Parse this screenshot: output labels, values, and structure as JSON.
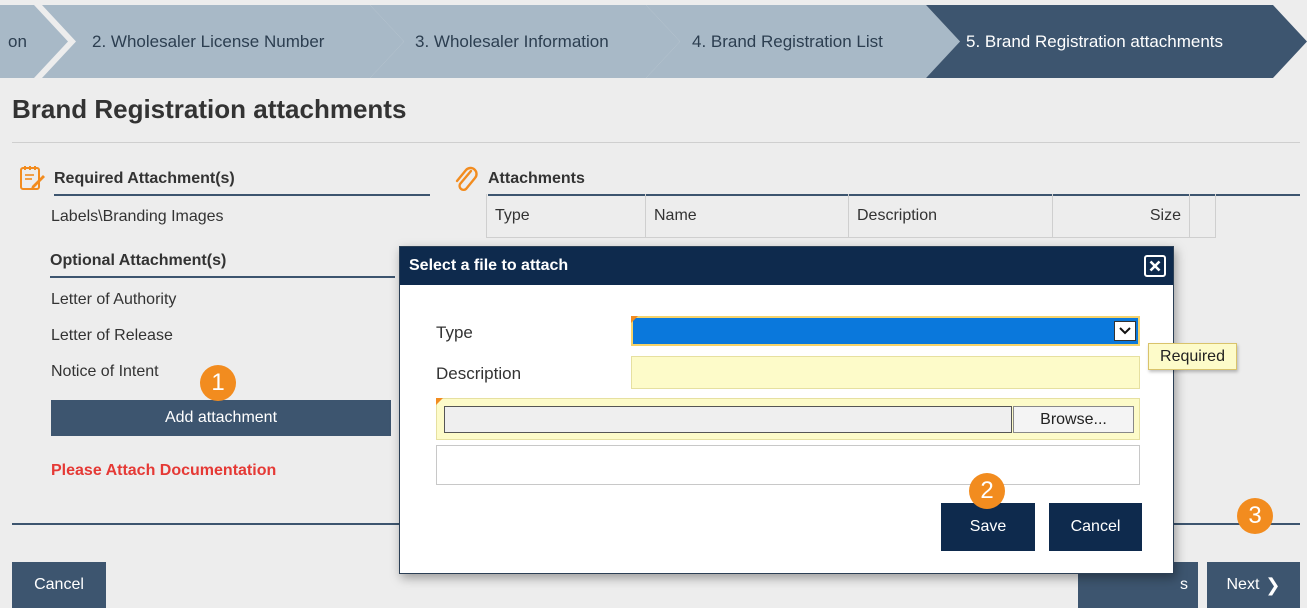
{
  "steps": [
    {
      "label": "on"
    },
    {
      "label": "2. Wholesaler License Number"
    },
    {
      "label": "3. Wholesaler Information"
    },
    {
      "label": "4. Brand Registration List"
    },
    {
      "label": "5. Brand Registration attachments"
    }
  ],
  "page": {
    "title": "Brand Registration attachments"
  },
  "required": {
    "heading": "Required Attachment(s)",
    "items": [
      "Labels\\Branding Images"
    ]
  },
  "optional": {
    "heading": "Optional Attachment(s)",
    "items": [
      "Letter of Authority",
      "Letter of Release",
      "Notice of Intent"
    ]
  },
  "add_attachment_label": "Add attachment",
  "warning": "Please Attach Documentation",
  "attachments": {
    "heading": "Attachments",
    "columns": [
      "Type",
      "Name",
      "Description",
      "Size"
    ]
  },
  "modal": {
    "title": "Select a file to attach",
    "type_label": "Type",
    "description_label": "Description",
    "browse_label": "Browse...",
    "save_label": "Save",
    "cancel_label": "Cancel"
  },
  "tooltip": "Required",
  "footer": {
    "cancel_label": "Cancel",
    "previous_partial": "s",
    "next_label": "Next"
  },
  "badges": [
    "1",
    "2",
    "3"
  ],
  "colors": {
    "step_inactive": "#a8b9c7",
    "step_active": "#3d556f",
    "primary_button": "#3d556f",
    "modal_header": "#0e2a4d",
    "warning": "#e53935",
    "badge": "#f28c1f",
    "required_field": "#fdfbc9",
    "select_highlight": "#0a78dc"
  },
  "icons": {
    "required": "notepad-pencil-icon",
    "attachments": "paperclip-icon",
    "close": "close-icon",
    "dropdown": "chevron-down-icon",
    "next": "chevron-right-icon"
  }
}
